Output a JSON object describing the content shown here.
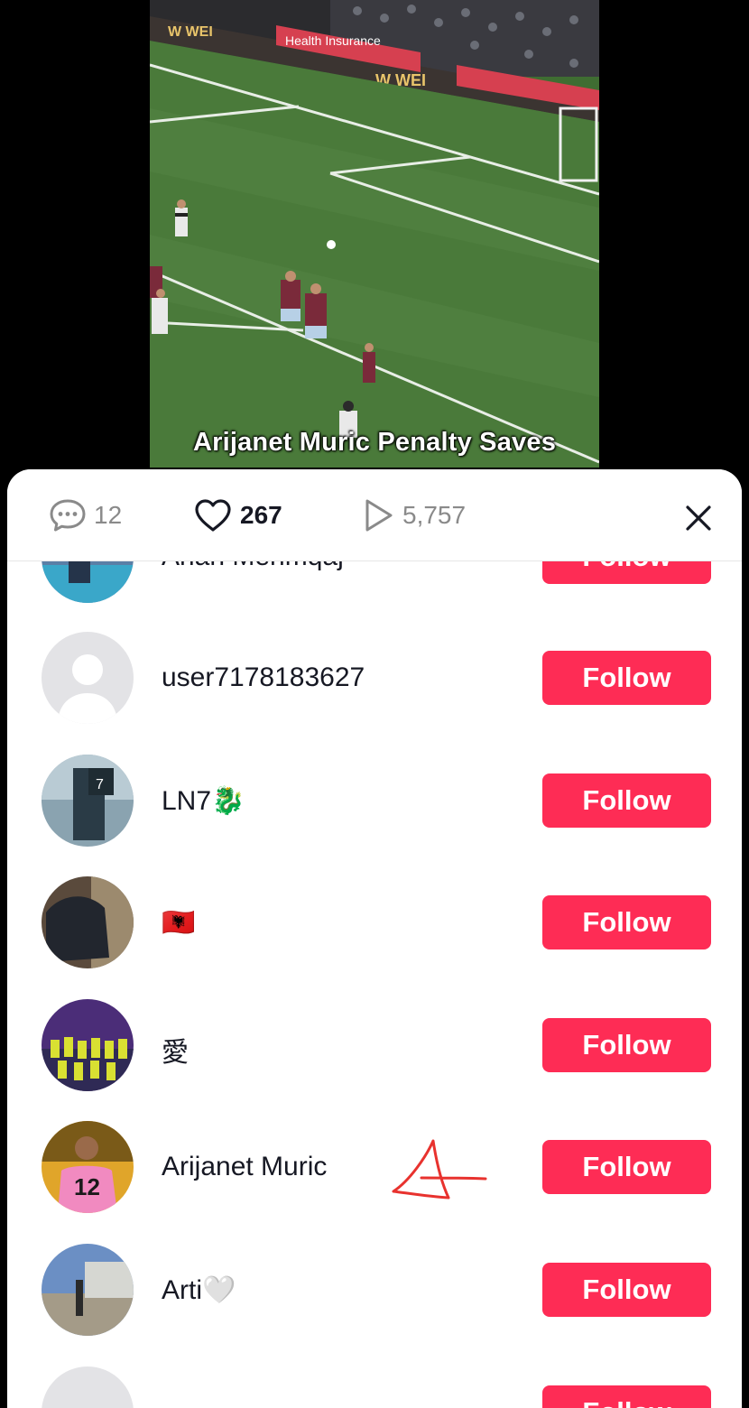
{
  "video": {
    "caption": "Arijanet Muric Penalty Saves",
    "board_text": "W WEI",
    "ad_text": "Health Insurance"
  },
  "stats": {
    "comments": "12",
    "likes": "267",
    "views": "5,757"
  },
  "users": [
    {
      "name": "Arian Mehmqaj",
      "follow": "Follow"
    },
    {
      "name": "user7178183627",
      "follow": "Follow"
    },
    {
      "name": "LN7🐉",
      "follow": "Follow"
    },
    {
      "name": "🇦🇱",
      "follow": "Follow"
    },
    {
      "name": "愛",
      "follow": "Follow"
    },
    {
      "name": "Arijanet Muric",
      "follow": "Follow"
    },
    {
      "name": "Arti🤍",
      "follow": "Follow"
    },
    {
      "name": "",
      "follow": "Follow"
    }
  ],
  "colors": {
    "follow_button": "#fe2c55",
    "scribble": "#e8322e",
    "pitch": "#3f6d32"
  },
  "icons": [
    "comment-icon",
    "heart-icon",
    "play-icon",
    "close-icon"
  ]
}
